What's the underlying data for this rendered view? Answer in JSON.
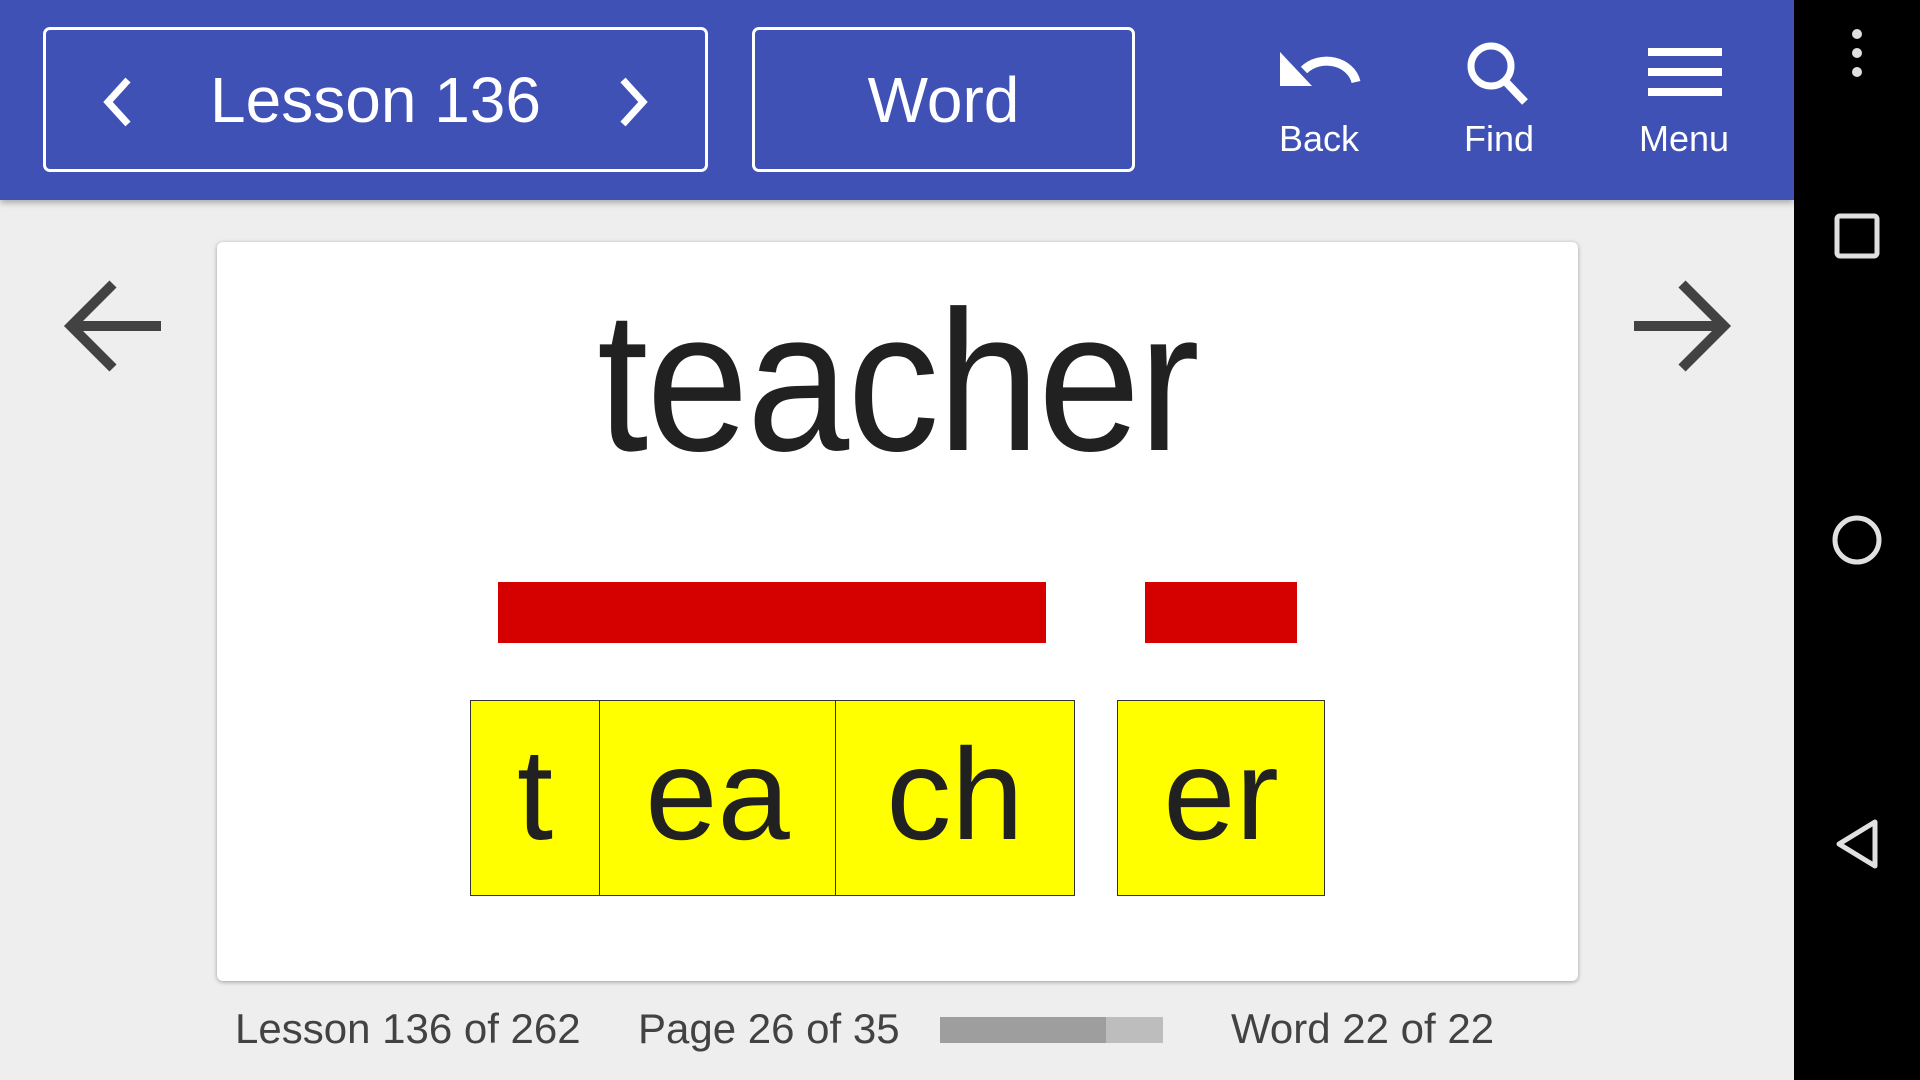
{
  "appbar": {
    "lesson_label": "Lesson 136",
    "prev_lesson_icon": "chevron-left-icon",
    "next_lesson_icon": "chevron-right-icon",
    "mode_label": "Word",
    "actions": [
      {
        "label": "Back",
        "icon": "undo-icon"
      },
      {
        "label": "Find",
        "icon": "search-icon"
      },
      {
        "label": "Menu",
        "icon": "hamburger-menu-icon"
      }
    ],
    "color": "#3f51b5"
  },
  "card": {
    "word": "teacher",
    "syllable_bars": [
      {
        "span": "teach"
      },
      {
        "span": "er"
      }
    ],
    "tiles": [
      "t",
      "ea",
      "ch",
      "er"
    ],
    "bar_color": "#d50000",
    "tile_color": "#ffff00"
  },
  "nav": {
    "prev_icon": "arrow-left-icon",
    "next_icon": "arrow-right-icon"
  },
  "status": {
    "lesson": "Lesson 136 of 262",
    "page": "Page 26 of 35",
    "page_progress": 0.743,
    "word": "Word 22 of 22"
  },
  "system_nav": [
    "overflow-dots-icon",
    "recents-icon",
    "home-icon",
    "back-triangle-icon"
  ]
}
